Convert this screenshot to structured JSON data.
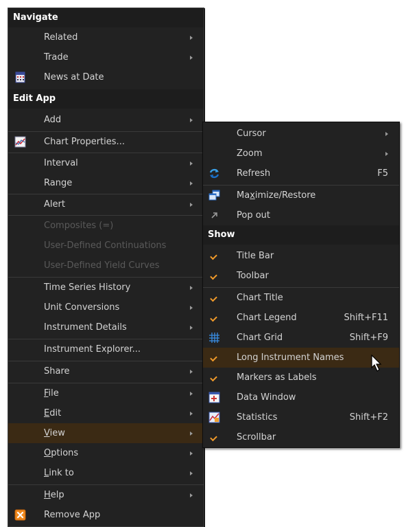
{
  "main_menu": {
    "navigate_header": "Navigate",
    "related": "Related",
    "trade": "Trade",
    "news_at_date": "News at Date",
    "edit_app_header": "Edit App",
    "add": "Add",
    "chart_properties": "Chart Properties...",
    "interval": "Interval",
    "range": "Range",
    "alert": "Alert",
    "composites": "Composites (=)",
    "user_defined_continuations": "User-Defined Continuations",
    "user_defined_yield_curves": "User-Defined Yield Curves",
    "time_series_history": "Time Series History",
    "unit_conversions": "Unit Conversions",
    "instrument_details": "Instrument Details",
    "instrument_explorer": "Instrument Explorer...",
    "share": "Share",
    "file_u": "F",
    "file_rest": "ile",
    "edit_u": "E",
    "edit_rest": "dit",
    "view_u": "V",
    "view_rest": "iew",
    "options_u": "O",
    "options_rest": "ptions",
    "link_u": "L",
    "link_rest": "ink to",
    "help_u": "H",
    "help_rest": "elp",
    "remove_app": "Remove App"
  },
  "view_submenu": {
    "cursor": "Cursor",
    "zoom": "Zoom",
    "refresh": "Refresh",
    "refresh_shortcut": "F5",
    "maximize_a": "Ma",
    "maximize_u": "x",
    "maximize_b": "imize/Restore",
    "pop_out": "Pop out",
    "show_header": "Show",
    "title_bar": "Title Bar",
    "toolbar": "Toolbar",
    "chart_title": "Chart Title",
    "chart_legend": "Chart Legend",
    "chart_legend_shortcut": "Shift+F11",
    "chart_grid": "Chart Grid",
    "chart_grid_shortcut": "Shift+F9",
    "long_instrument_names": "Long Instrument Names",
    "markers_as_labels": "Markers as Labels",
    "data_window": "Data Window",
    "statistics": "Statistics",
    "statistics_shortcut": "Shift+F2",
    "scrollbar": "Scrollbar"
  },
  "colors": {
    "menu_bg": "#222222",
    "highlight": "#3b2a14",
    "check": "#f09a2a",
    "disabled": "#5a5a5a"
  },
  "icons": [
    "calculator-icon",
    "chart-properties-icon",
    "refresh-icon",
    "maximize-restore-icon",
    "pop-out-icon",
    "grid-icon",
    "data-window-icon",
    "statistics-icon",
    "remove-icon",
    "cursor-pointer-icon"
  ]
}
